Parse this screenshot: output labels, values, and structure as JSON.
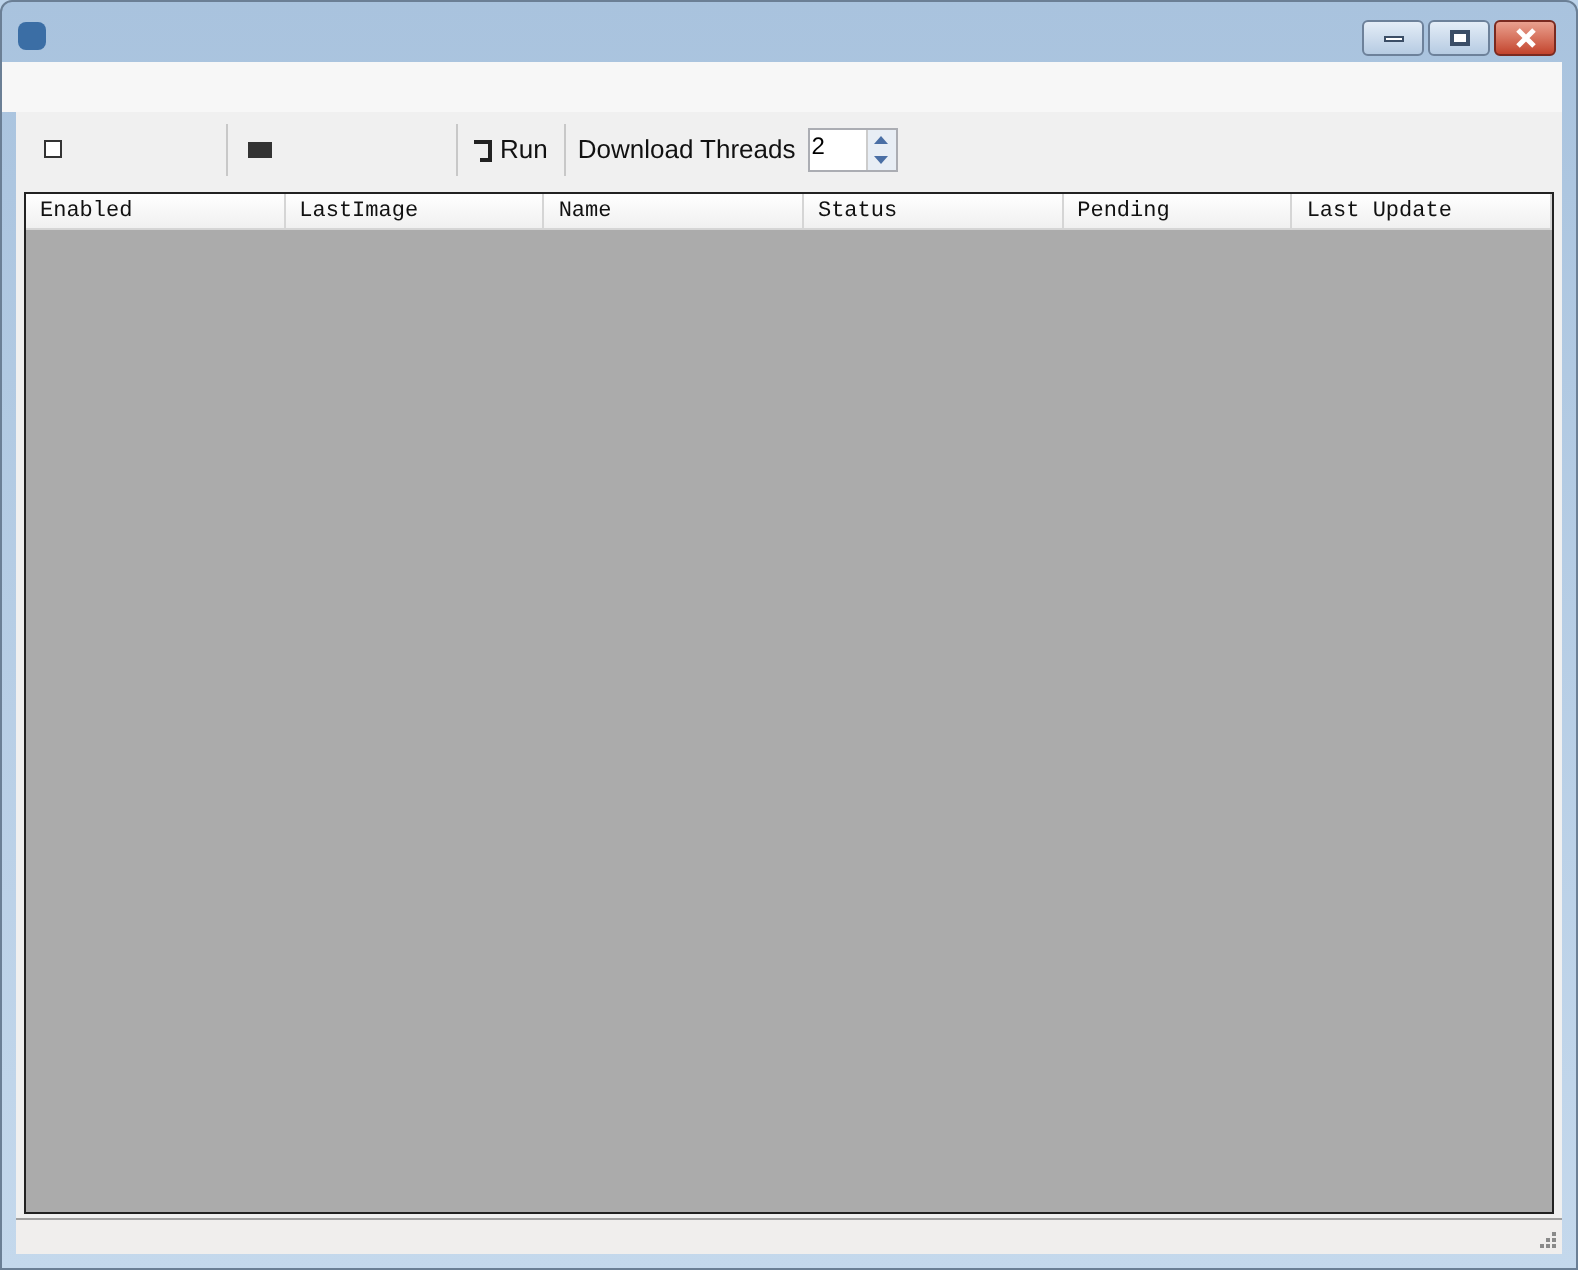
{
  "toolbar": {
    "run_button": {
      "label": "Run"
    },
    "download_threads": {
      "label": "Download Threads",
      "value": "2"
    }
  },
  "table": {
    "columns": [
      "Enabled",
      "LastImage",
      "Name",
      "Status",
      "Pending",
      "Last Update"
    ]
  }
}
